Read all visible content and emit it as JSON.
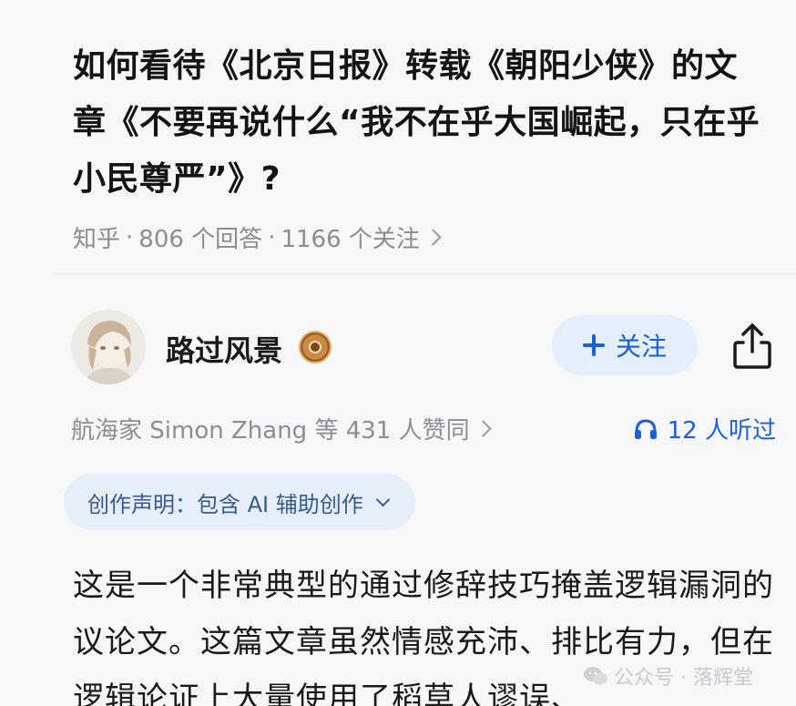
{
  "question": {
    "title": "如何看待《北京日报》转载《朝阳少侠》的文章《不要再说什么“我不在乎大国崛起，只在乎小民尊严”》?",
    "source": "知乎",
    "answers": "806 个回答",
    "followers": "1166 个关注"
  },
  "answer": {
    "author_name": "路过风景",
    "follow_label": "关注",
    "voters_text": "航海家 Simon Zhang 等 431 人赞同",
    "listen_text": "12 人听过",
    "statement_label": "创作声明：包含 AI 辅助创作",
    "body": "这是一个非常典型的通过修辞技巧掩盖逻辑漏洞的议论文。这篇文章虽然情感充沛、排比有力，但在逻辑论证上大量使用了稻草人谬误、"
  },
  "watermark": {
    "text": "公众号 · 落辉堂"
  },
  "colors": {
    "accent": "#1c5fd6",
    "chip_bg": "#e5eefb",
    "meta_gray": "#8c8c94",
    "background": "#f7f7f8"
  },
  "icons": [
    "chevron-right-icon",
    "verified-badge-icon",
    "plus-icon",
    "share-icon",
    "headphone-icon",
    "chevron-down-icon",
    "wechat-icon"
  ]
}
